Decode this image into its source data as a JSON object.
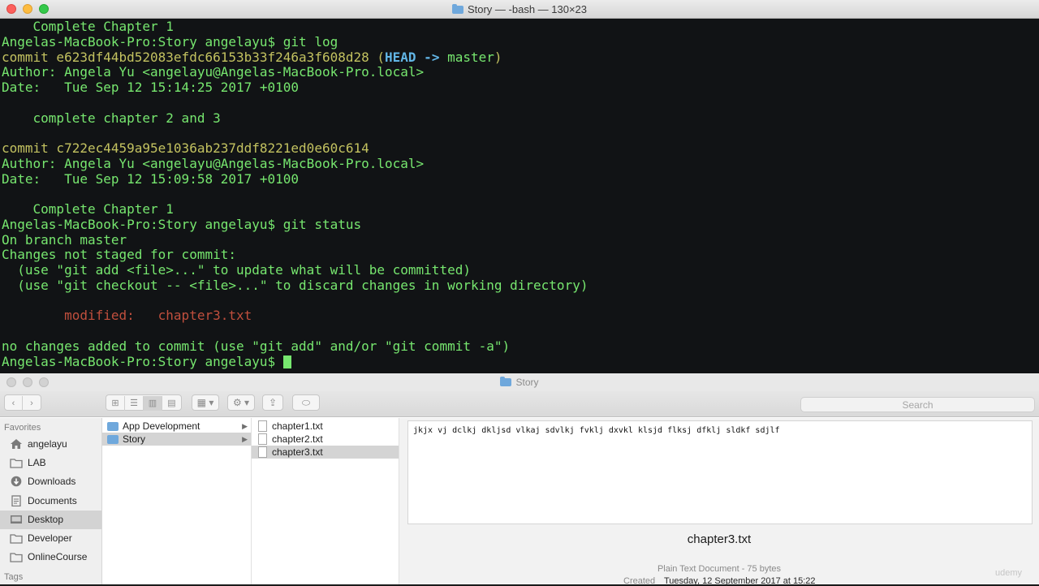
{
  "terminal": {
    "title": "Story — -bash — 130×23",
    "lines": {
      "l01": "    Complete Chapter 1",
      "l02": "Angelas-MacBook-Pro:Story angelayu$ git log",
      "l03_prefix": "commit e623df44bd52083efdc66153b33f246a3f608d28 (",
      "l03_head": "HEAD -> ",
      "l03_branch": "master",
      "l03_suffix": ")",
      "l04": "Author: Angela Yu <angelayu@Angelas-MacBook-Pro.local>",
      "l05": "Date:   Tue Sep 12 15:14:25 2017 +0100",
      "l06": "",
      "l07": "    complete chapter 2 and 3",
      "l08": "",
      "l09": "commit c722ec4459a95e1036ab237ddf8221ed0e60c614",
      "l10": "Author: Angela Yu <angelayu@Angelas-MacBook-Pro.local>",
      "l11": "Date:   Tue Sep 12 15:09:58 2017 +0100",
      "l12": "",
      "l13": "    Complete Chapter 1",
      "l14": "Angelas-MacBook-Pro:Story angelayu$ git status",
      "l15": "On branch master",
      "l16": "Changes not staged for commit:",
      "l17": "  (use \"git add <file>...\" to update what will be committed)",
      "l18": "  (use \"git checkout -- <file>...\" to discard changes in working directory)",
      "l19": "",
      "l20": "        modified:   chapter3.txt",
      "l21": "",
      "l22": "no changes added to commit (use \"git add\" and/or \"git commit -a\")",
      "l23": "Angelas-MacBook-Pro:Story angelayu$ "
    }
  },
  "finder": {
    "title": "Story",
    "search_placeholder": "Search",
    "toolbar": {
      "back": "‹",
      "forward": "›",
      "view_icons": "⊞",
      "view_list": "☰",
      "view_columns": "▥",
      "view_gallery": "▤",
      "arrange": "▦ ▾",
      "action": "⚙ ▾",
      "share": "⇪",
      "tag": "⬭"
    },
    "sidebar": {
      "favorites_header": "Favorites",
      "tags_header": "Tags",
      "items": [
        {
          "label": "angelayu",
          "icon": "home-icon"
        },
        {
          "label": "LAB",
          "icon": "folder-icon"
        },
        {
          "label": "Downloads",
          "icon": "downloads-icon"
        },
        {
          "label": "Documents",
          "icon": "documents-icon"
        },
        {
          "label": "Desktop",
          "icon": "desktop-icon"
        },
        {
          "label": "Developer",
          "icon": "folder-icon"
        },
        {
          "label": "OnlineCourse",
          "icon": "folder-icon"
        }
      ]
    },
    "column1": [
      "App Development",
      "Story"
    ],
    "column2": [
      "chapter1.txt",
      "chapter2.txt",
      "chapter3.txt"
    ],
    "preview": {
      "content": "jkjx vj dclkj dkljsd vlkaj sdvlkj fvklj dxvkl klsjd flksj dfklj sldkf sdjlf",
      "filename": "chapter3.txt",
      "kind": "Plain Text Document - 75 bytes",
      "created_label": "Created",
      "created_value": "Tuesday, 12 September 2017 at 15:22"
    },
    "watermark": "udemy"
  },
  "colors": {
    "terminal_bg": "#111315",
    "terminal_text": "#77e76f",
    "commit_hash": "#c3c260",
    "head_ref": "#62b6e6",
    "modified": "#c04f3d",
    "folder": "#6fa8dc"
  }
}
